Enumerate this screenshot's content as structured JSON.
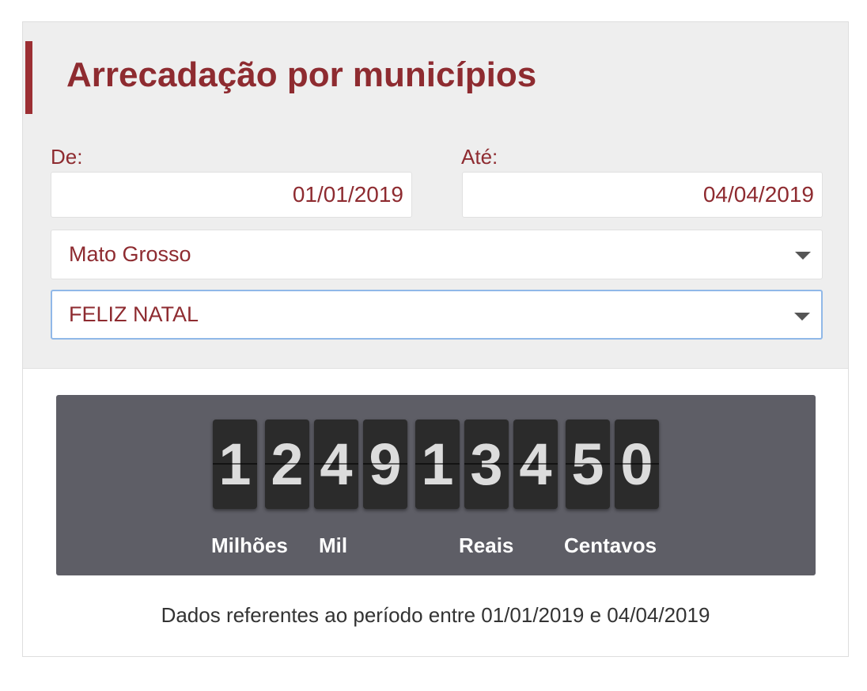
{
  "header": {
    "title": "Arrecadação por municípios"
  },
  "filters": {
    "from_label": "De:",
    "from_value": "01/01/2019",
    "to_label": "Até:",
    "to_value": "04/04/2019",
    "state": "Mato Grosso",
    "municipality": "FELIZ NATAL"
  },
  "counter": {
    "digits": [
      "1",
      "2",
      "4",
      "9",
      "1",
      "3",
      "4",
      "5",
      "0"
    ],
    "units": {
      "millions": "Milhões",
      "thousands": "Mil",
      "reais": "Reais",
      "cents": "Centavos"
    }
  },
  "footer": {
    "text": "Dados referentes ao período entre 01/01/2019 e 04/04/2019"
  },
  "colors": {
    "accent": "#8e2b30",
    "panel_bg": "#eeeeee",
    "counter_bg": "#5e5e66",
    "digit_bg": "#2b2b2b",
    "focus_border": "#90b8e8"
  },
  "icons": {
    "select_caret": "caret-down-icon"
  }
}
